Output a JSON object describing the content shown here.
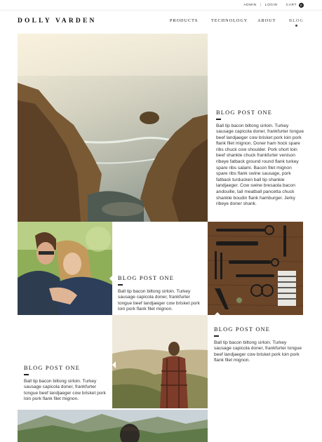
{
  "utility": {
    "admin": "ADMIN",
    "separator": "|",
    "login": "LOGIN",
    "cart": "CART",
    "cart_count": "0"
  },
  "brand": {
    "logo": "DOLLY VARDEN"
  },
  "nav": {
    "items": [
      {
        "label": "PRODUCTS"
      },
      {
        "label": "TECHNOLOGY"
      },
      {
        "label": "ABOUT"
      },
      {
        "label": "BLOG",
        "active": true
      }
    ]
  },
  "posts": [
    {
      "title": "BLOG POST ONE",
      "excerpt": "Ball tip bacon biltong sirloin. Turkey sausage capicola doner, frankfurter tongue beef landjaeger cow brisket pork loin pork flank filet mignon. Doner ham hock spare ribs chuck cow shoulder. Pork short loin beef shankle chuck frankfurter venison ribeye fatback ground round flank turkey spare ribs salami. Bacon filet mignon spare ribs flank swine sausage, pork fatback turducken ball tip shankie landjaeger. Cow swine bresaola bacon andouille, tail meatball pancetta chuck shankle boudin flank hamburger. Jerky ribeye doner shank."
    },
    {
      "title": "BLOG POST ONE",
      "excerpt": "Ball tip bacon biltong sirloin. Turkey sausage capicola doner, frankfurter tongue beef landjaeger cow brisket pork loin pork flank filet mignon."
    },
    {
      "title": "BLOG POST ONE",
      "excerpt": "Ball tip bacon biltong sirloin. Turkey sausage capicola doner, frankfurter tongue beef landjaeger cow brisket pork loin pork flank filet mignon."
    },
    {
      "title": "BLOG POST ONE",
      "excerpt": "Ball tip bacon biltong sirloin. Turkey sausage capicola doner, frankfurter tongue beef landjaeger cow brisket pork loin pork flank filet mignon."
    }
  ],
  "colors": {
    "text": "#222222",
    "accent": "#111111",
    "divider": "#ececec"
  },
  "images": {
    "coast": "coastal-cliffs-photo",
    "couple": "smiling-couple-photo",
    "tools": "tools-on-wood-photo",
    "man_valley": "man-overlooking-valley-photo",
    "mountains": "mountain-landscape-photo"
  }
}
